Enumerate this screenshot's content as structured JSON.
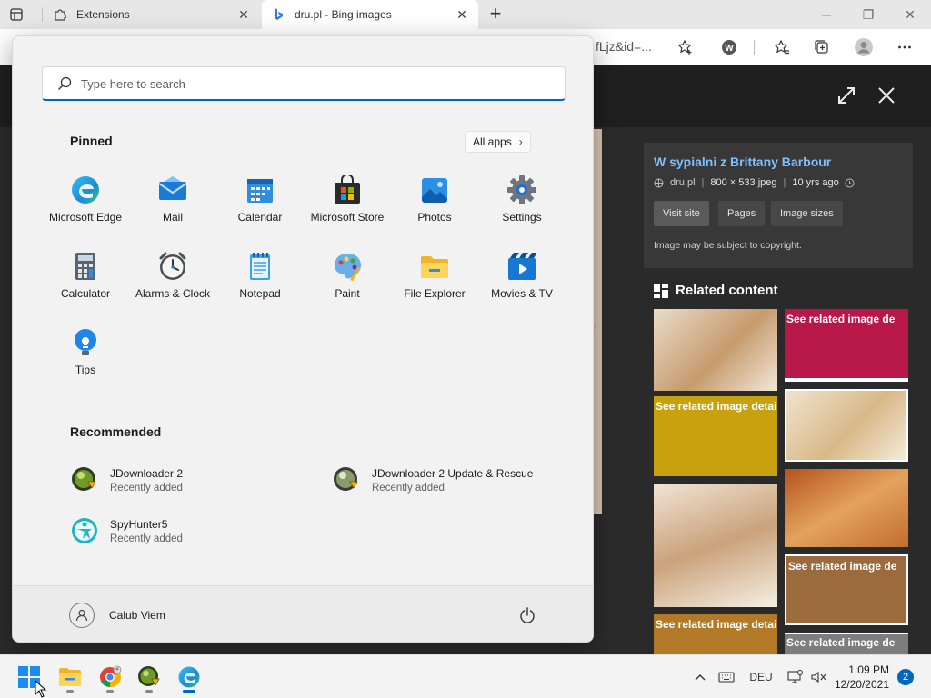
{
  "browser": {
    "tabs": [
      {
        "title": "Extensions",
        "icon": "puzzle-icon"
      },
      {
        "title": "dru.pl - Bing images",
        "icon": "bing-icon"
      }
    ],
    "address_tail": "fLjz&id=...",
    "toolbar_icons": [
      "add-favorite-icon",
      "extension-w-icon",
      "favorites-icon",
      "collections-icon",
      "profile-icon",
      "more-icon"
    ]
  },
  "viewer": {
    "image_title": "W sypialni z Brittany Barbour",
    "meta": {
      "site": "dru.pl",
      "dimensions": "800 × 533 jpeg",
      "age": "10 yrs ago"
    },
    "buttons": [
      "Visit site",
      "Pages",
      "Image sizes"
    ],
    "copyright": "Image may be subject to copyright.",
    "related_title": "Related content",
    "thumbs": [
      {
        "alt": ""
      },
      {
        "alt": "See related image de"
      },
      {
        "alt": "See related image detail"
      },
      {
        "alt": ""
      },
      {
        "alt": ""
      },
      {
        "alt": ""
      },
      {
        "alt": "See related image de"
      },
      {
        "alt": "See related image detail"
      },
      {
        "alt": "See related image de"
      }
    ]
  },
  "start_menu": {
    "search_placeholder": "Type here to search",
    "pinned_title": "Pinned",
    "all_apps_label": "All apps",
    "pinned": [
      {
        "label": "Microsoft Edge",
        "icon": "edge-icon"
      },
      {
        "label": "Mail",
        "icon": "mail-icon"
      },
      {
        "label": "Calendar",
        "icon": "calendar-icon"
      },
      {
        "label": "Microsoft Store",
        "icon": "store-icon"
      },
      {
        "label": "Photos",
        "icon": "photos-icon"
      },
      {
        "label": "Settings",
        "icon": "settings-gear-icon"
      },
      {
        "label": "Calculator",
        "icon": "calculator-icon"
      },
      {
        "label": "Alarms & Clock",
        "icon": "clock-icon"
      },
      {
        "label": "Notepad",
        "icon": "notepad-icon"
      },
      {
        "label": "Paint",
        "icon": "paint-palette-icon"
      },
      {
        "label": "File Explorer",
        "icon": "folder-icon"
      },
      {
        "label": "Movies & TV",
        "icon": "play-icon"
      },
      {
        "label": "Tips",
        "icon": "lightbulb-icon"
      }
    ],
    "recommended_title": "Recommended",
    "recommended": [
      {
        "name": "JDownloader 2",
        "sub": "Recently added"
      },
      {
        "name": "JDownloader 2 Update & Rescue",
        "sub": "Recently added"
      },
      {
        "name": "SpyHunter5",
        "sub": "Recently added"
      }
    ],
    "user_name": "Calub Viem"
  },
  "taskbar": {
    "language": "DEU",
    "time": "1:09 PM",
    "date": "12/20/2021",
    "notifications": "2"
  },
  "colors": {
    "accent": "#0067c0",
    "bing_title": "#7fbfff"
  }
}
